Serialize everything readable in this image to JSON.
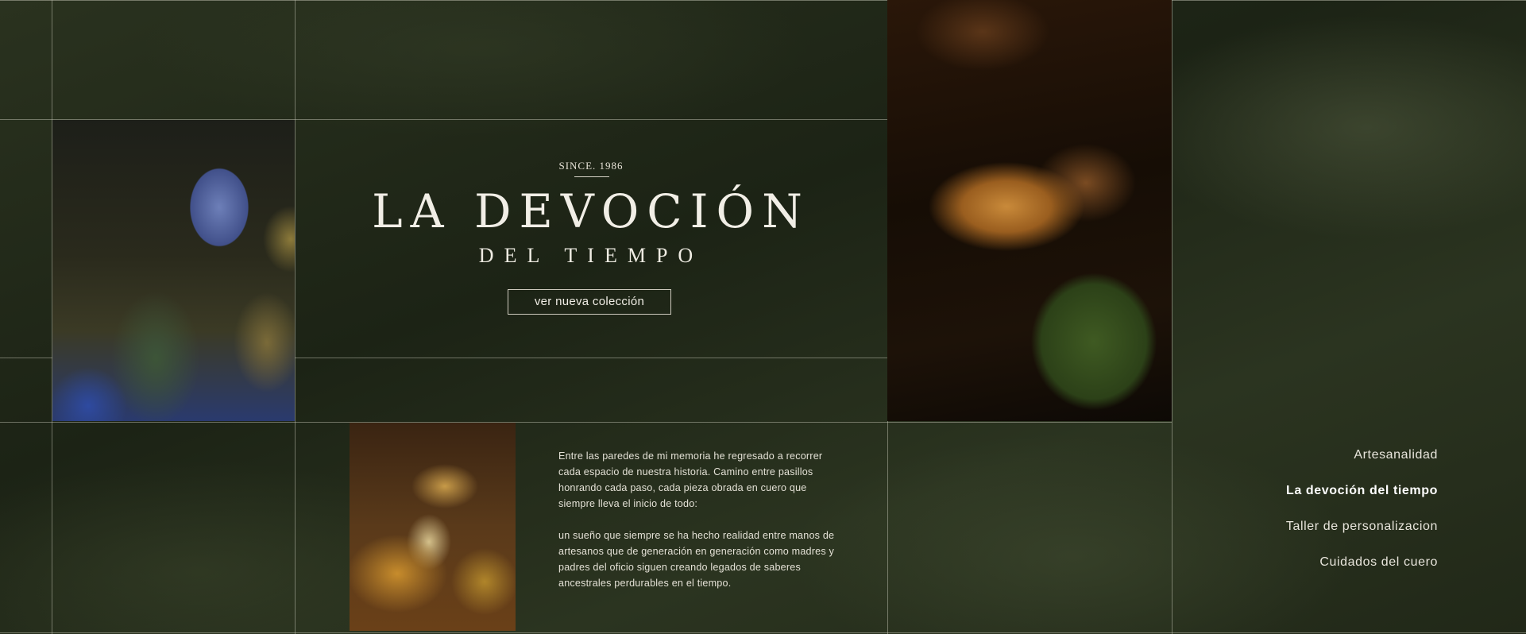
{
  "hero": {
    "since": "SINCE. 1986",
    "title": "LA DEVOCIÓN",
    "subtitle": "DEL TIEMPO",
    "cta_label": "ver nueva colección"
  },
  "story": {
    "paragraphs": [
      "Entre las paredes de mi memoria he regresado a recorrer cada espacio de nuestra historia. Camino entre pasillos honrando cada paso, cada pieza obrada en cuero que siempre lleva el inicio de todo:",
      "un sueño que siempre se ha hecho realidad entre manos de artesanos que de generación en generación como madres y padres del oficio siguen creando legados de saberes ancestrales perdurables en el tiempo."
    ]
  },
  "nav": {
    "items": [
      {
        "label": "Artesanalidad"
      },
      {
        "label": "La devoción del tiempo"
      },
      {
        "label": "Taller de personalizacion"
      },
      {
        "label": "Cuidados del cuero"
      }
    ],
    "active_index": 1
  },
  "colors": {
    "background": "#262d1c",
    "grid_line": "#d2d2c3",
    "text": "#f1eee6"
  }
}
